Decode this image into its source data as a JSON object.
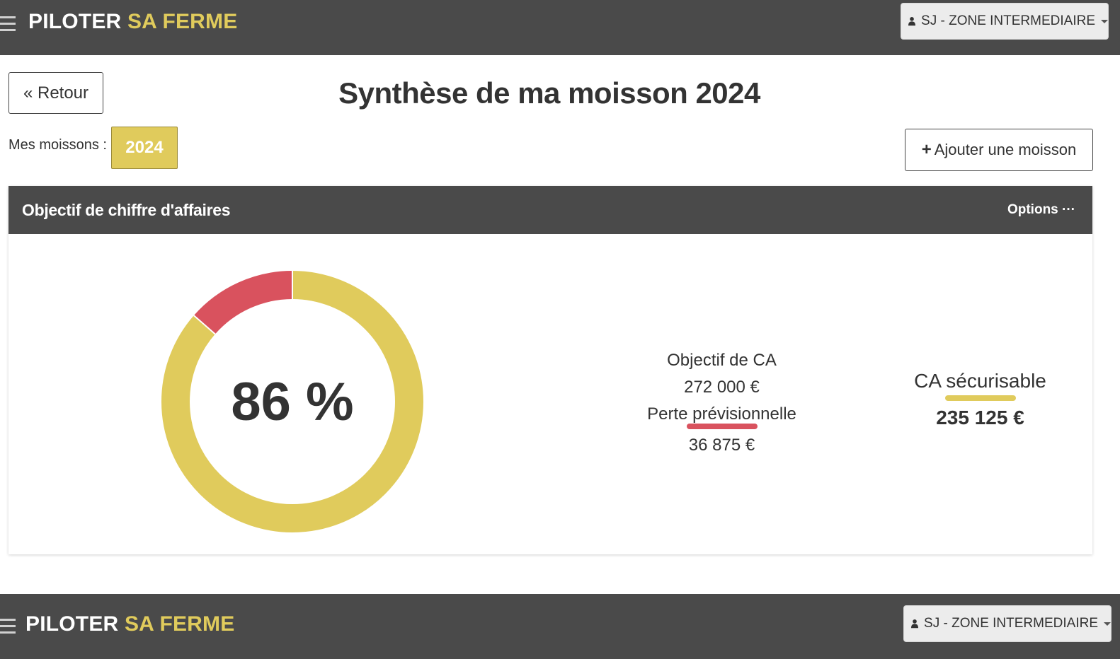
{
  "app": {
    "brand_part1": "PILOTER",
    "brand_part2": "SA FERME",
    "brand_color": "#e0cb5c",
    "nav_color": "#4a4a4a"
  },
  "user": {
    "label": "SJ - ZONE INTERMEDIAIRE"
  },
  "page": {
    "back_label": "« Retour",
    "title": "Synthèse de ma moisson 2024"
  },
  "harvests": {
    "label": "Mes moissons :",
    "years": [
      "2024"
    ],
    "add_label": "Ajouter une moisson"
  },
  "panel": {
    "title": "Objectif de chiffre d'affaires",
    "options_label": "Options ···",
    "percent_label": "86 %",
    "objective_label": "Objectif de CA",
    "objective_value": "272 000 €",
    "loss_label": "Perte prévisionnelle",
    "loss_value": "36 875 €",
    "secured_label": "CA sécurisable",
    "secured_value": "235 125 €",
    "colors": {
      "secured": "#e0cb5c",
      "loss": "#d9525e"
    }
  },
  "chart_data": {
    "type": "pie",
    "categories": [
      "CA sécurisable",
      "Perte prévisionnelle"
    ],
    "values": [
      235125,
      36875
    ],
    "center_label": "86 %"
  }
}
